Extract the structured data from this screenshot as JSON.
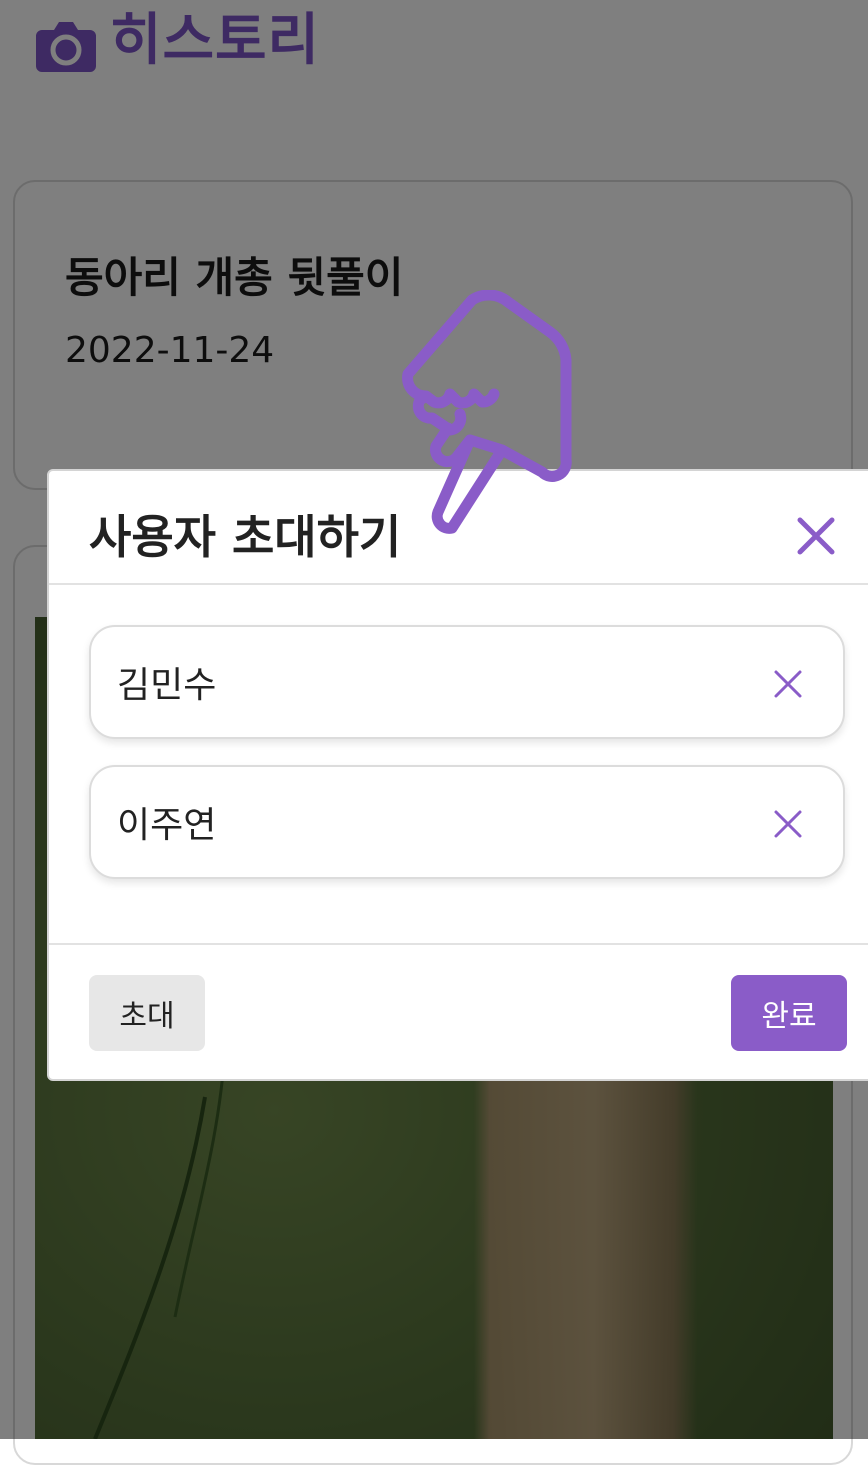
{
  "page": {
    "title": "히스토리",
    "title_icon": "camera-icon"
  },
  "history_card": {
    "title": "동아리 개총 뒷풀이",
    "date": "2022-11-24"
  },
  "modal": {
    "title": "사용자 초대하기",
    "close_icon": "close-icon",
    "invitees": [
      {
        "name": "김민수",
        "remove_icon": "close-icon"
      },
      {
        "name": "이주연",
        "remove_icon": "close-icon"
      }
    ],
    "invite_label": "초대",
    "done_label": "완료"
  },
  "tap_hint": {
    "icon": "pointing-hand-icon"
  },
  "colors": {
    "accent": "#8a5cc8",
    "overlay": "rgba(0,0,0,0.5)",
    "secondary_button": "#e7e7e7"
  }
}
